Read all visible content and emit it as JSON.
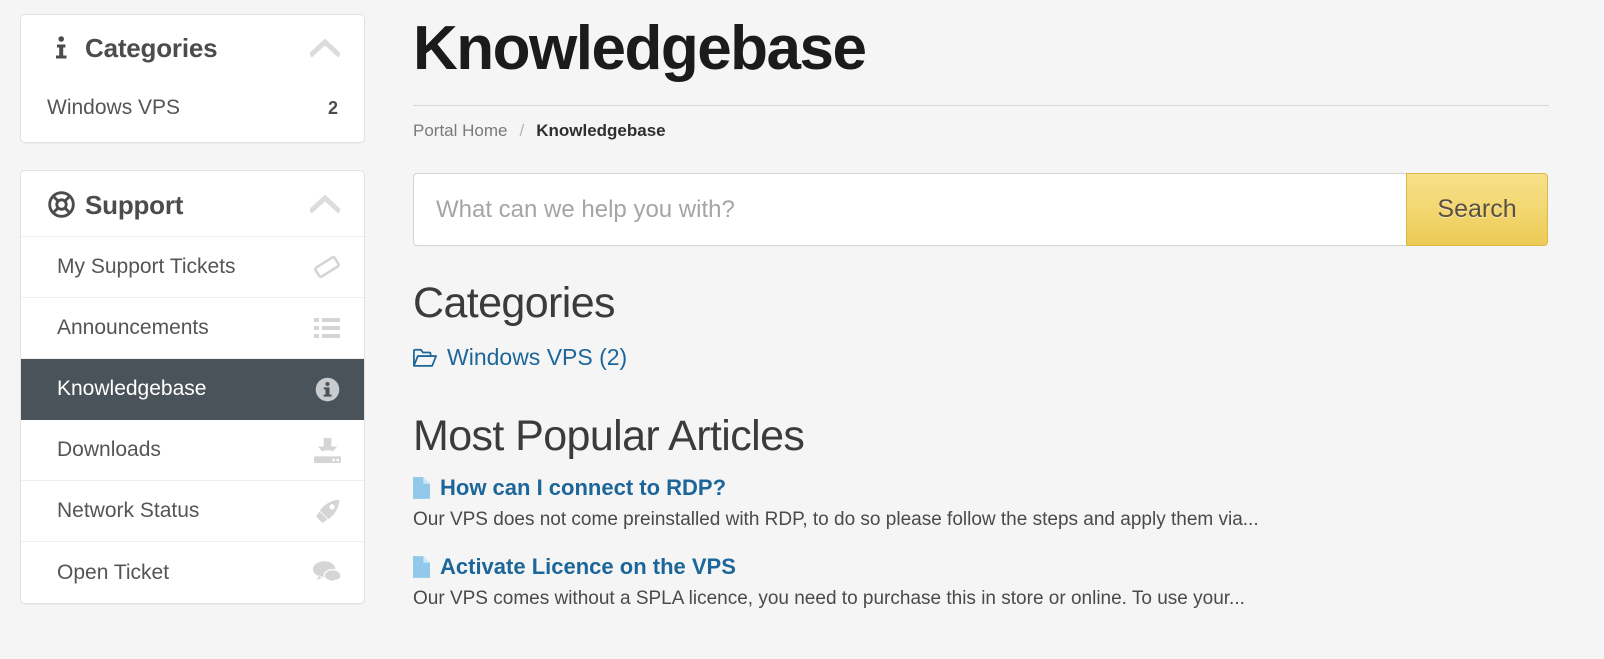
{
  "sidebar": {
    "categories_panel": {
      "icon": "info-icon",
      "title": "Categories",
      "toggle_icon": "chevron-up-icon",
      "rows": [
        {
          "label": "Windows VPS",
          "count": "2"
        }
      ]
    },
    "support_panel": {
      "icon": "life-ring-icon",
      "title": "Support",
      "toggle_icon": "chevron-up-icon",
      "items": [
        {
          "label": "My Support Tickets",
          "icon": "ticket-icon",
          "active": false
        },
        {
          "label": "Announcements",
          "icon": "list-icon",
          "active": false
        },
        {
          "label": "Knowledgebase",
          "icon": "info-circle-icon",
          "active": true
        },
        {
          "label": "Downloads",
          "icon": "download-icon",
          "active": false
        },
        {
          "label": "Network Status",
          "icon": "rocket-icon",
          "active": false
        },
        {
          "label": "Open Ticket",
          "icon": "comments-icon",
          "active": false
        }
      ]
    }
  },
  "main": {
    "page_title": "Knowledgebase",
    "breadcrumb": {
      "home": "Portal Home",
      "separator": "/",
      "current": "Knowledgebase"
    },
    "search": {
      "placeholder": "What can we help you with?",
      "value": "",
      "button_label": "Search"
    },
    "categories_section": {
      "heading": "Categories",
      "links": [
        {
          "label": "Windows VPS (2)",
          "icon": "folder-open-icon"
        }
      ]
    },
    "popular_section": {
      "heading": "Most Popular Articles",
      "articles": [
        {
          "icon": "file-icon",
          "title": "How can I connect to RDP?",
          "excerpt": "Our VPS does not come preinstalled with RDP, to do so please follow the steps and apply them via..."
        },
        {
          "icon": "file-icon",
          "title": "Activate Licence on the VPS",
          "excerpt": "Our VPS comes without a SPLA licence, you need to purchase this in store or online. To use your..."
        }
      ]
    }
  },
  "colors": {
    "page_background": "#f5f5f5",
    "panel_background": "#ffffff",
    "active_item_background": "#4a535a",
    "link_blue": "#1d6699",
    "file_icon_blue": "#92c9ea",
    "search_button_gold": "#f3d874"
  }
}
